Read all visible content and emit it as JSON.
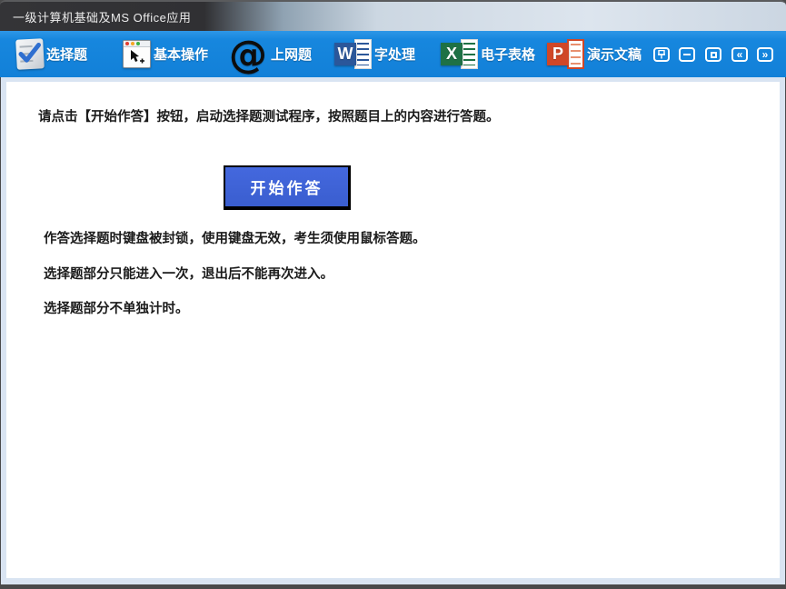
{
  "window": {
    "title": "一级计算机基础及MS Office应用"
  },
  "toolbar": {
    "items": [
      {
        "label": "选择题",
        "icon": "multiple-choice-icon"
      },
      {
        "label": "基本操作",
        "icon": "basic-operations-icon"
      },
      {
        "label": "上网题",
        "icon": "internet-icon",
        "glyph": "@"
      },
      {
        "label": "字处理",
        "icon": "word-icon",
        "letter": "W"
      },
      {
        "label": "电子表格",
        "icon": "excel-icon",
        "letter": "X"
      },
      {
        "label": "演示文稿",
        "icon": "powerpoint-icon",
        "letter": "P"
      }
    ],
    "window_buttons": [
      {
        "name": "pin"
      },
      {
        "name": "minimize"
      },
      {
        "name": "maximize"
      },
      {
        "name": "collapse-left",
        "glyph": "«"
      },
      {
        "name": "collapse-right",
        "glyph": "»"
      }
    ]
  },
  "content": {
    "instruction": "请点击【开始作答】按钮，启动选择题测试程序，按照题目上的内容进行答题。",
    "start_button_label": "开始作答",
    "notes": [
      "作答选择题时键盘被封锁，使用键盘无效，考生须使用鼠标答题。",
      "选择题部分只能进入一次，退出后不能再次进入。",
      "选择题部分不单独计时。"
    ]
  },
  "colors": {
    "toolbar_blue": "#1583db",
    "button_blue": "#3e63d6",
    "word_blue": "#2b579a",
    "excel_green": "#1e7145",
    "powerpoint_red": "#d04727"
  }
}
